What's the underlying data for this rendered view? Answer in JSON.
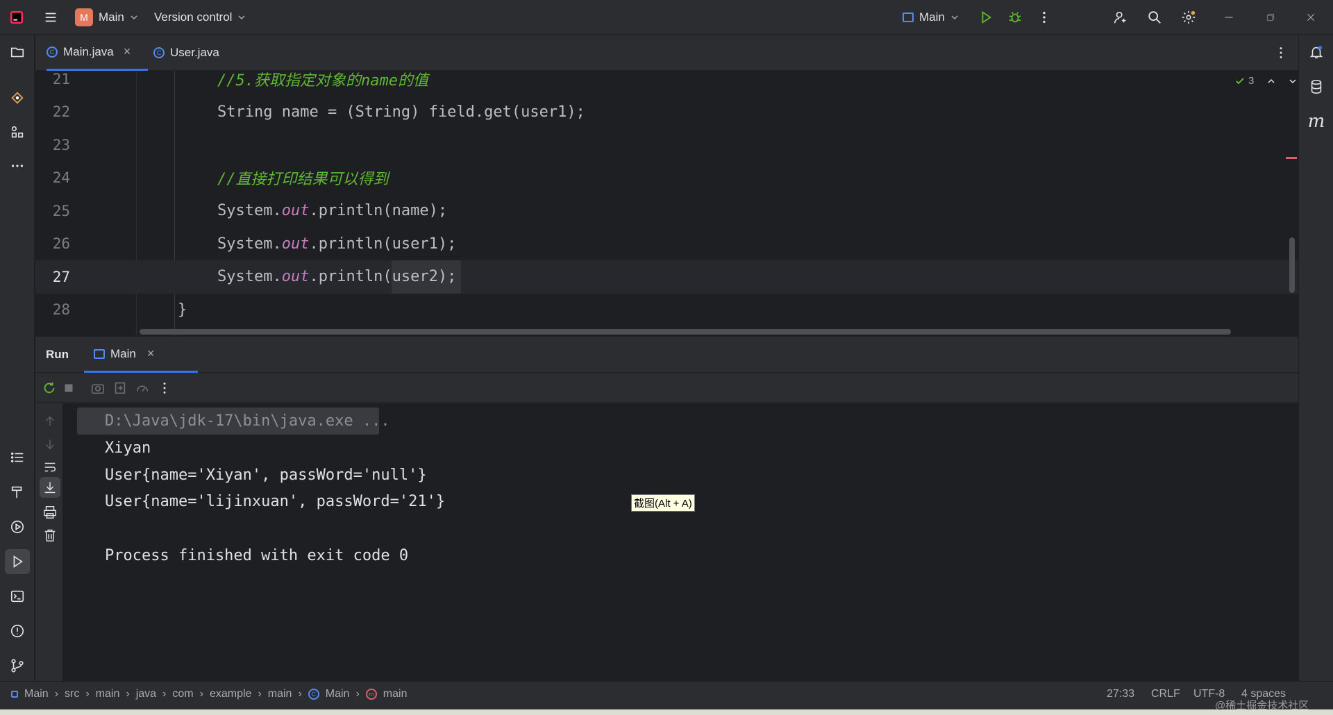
{
  "titlebar": {
    "project_badge": "M",
    "project_name": "Main",
    "vcs_label": "Version control",
    "run_config": "Main"
  },
  "tabs": [
    {
      "label": "Main.java",
      "close": "×"
    },
    {
      "label": "User.java"
    }
  ],
  "editor": {
    "inspection_count": "3",
    "lines": [
      {
        "num": "21",
        "text": "//5.获取指定对象的name的值"
      },
      {
        "num": "22",
        "text": "String name = (String) field.get(user1);"
      },
      {
        "num": "23",
        "text": ""
      },
      {
        "num": "24",
        "text": "//直接打印结果可以得到"
      },
      {
        "num": "25",
        "pre": "System.",
        "field": "out",
        "post": ".println(name);"
      },
      {
        "num": "26",
        "pre": "System.",
        "field": "out",
        "post": ".println(user1);"
      },
      {
        "num": "27",
        "pre": "System.",
        "field": "out",
        "post": ".println(user2);"
      },
      {
        "num": "28",
        "text": "}"
      }
    ]
  },
  "run": {
    "title": "Run",
    "tab_label": "Main",
    "tab_close": "×",
    "console": [
      "D:\\Java\\jdk-17\\bin\\java.exe ...",
      "Xiyan",
      "User{name='Xiyan', passWord='null'}",
      "User{name='lijinxuan', passWord='21'}",
      "",
      "Process finished with exit code 0"
    ],
    "tooltip": "截图(Alt + A)"
  },
  "statusbar": {
    "breadcrumbs": [
      "Main",
      "src",
      "main",
      "java",
      "com",
      "example",
      "main",
      "Main",
      "main"
    ],
    "position": "27:33",
    "line_sep": "CRLF",
    "encoding": "UTF-8",
    "indent": "4 spaces"
  },
  "watermark": "@稀土掘金技术社区",
  "colors": {
    "comment": "#5fb832",
    "field": "#c77dbb",
    "accent": "#3574f0",
    "run_green": "#5fb832"
  }
}
